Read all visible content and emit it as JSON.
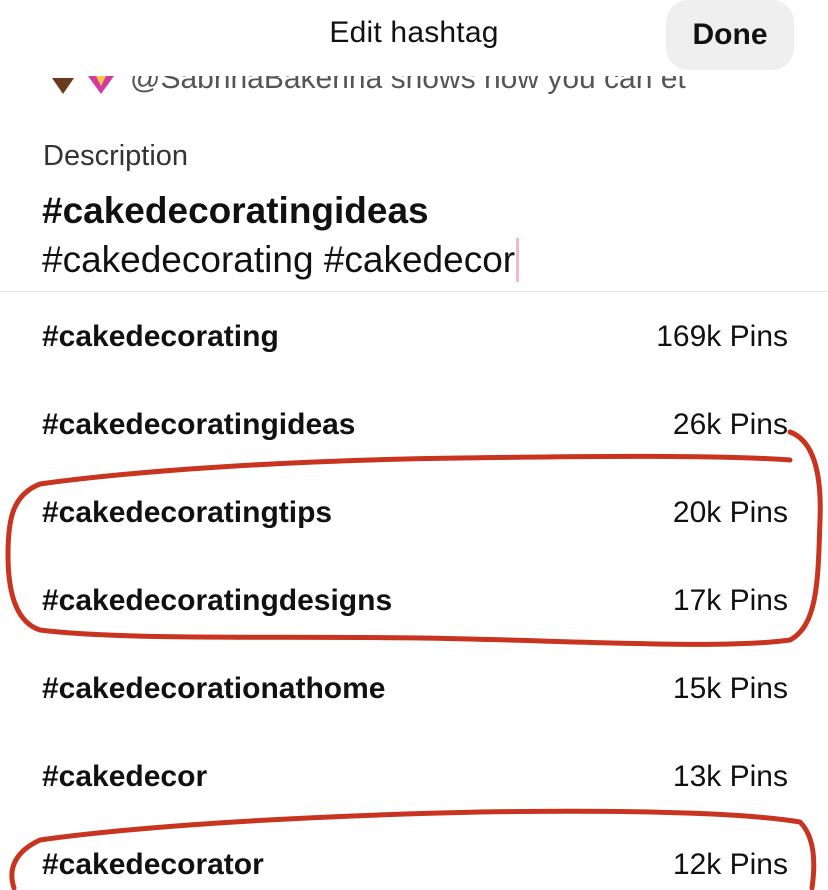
{
  "header": {
    "title": "Edit hashtag",
    "done_label": "Done"
  },
  "peek_row": {
    "text": "@SabrinaBakerina shows how you can et"
  },
  "description": {
    "label": "Description",
    "line1": "#cakedecoratingideas",
    "line2": "#cakedecorating #cakedecor"
  },
  "suggestions": [
    {
      "tag": "#cakedecorating",
      "count": "169k Pins"
    },
    {
      "tag": "#cakedecoratingideas",
      "count": "26k Pins"
    },
    {
      "tag": "#cakedecoratingtips",
      "count": "20k Pins"
    },
    {
      "tag": "#cakedecoratingdesigns",
      "count": "17k Pins"
    },
    {
      "tag": "#cakedecorationathome",
      "count": "15k Pins"
    },
    {
      "tag": "#cakedecor",
      "count": "13k Pins"
    },
    {
      "tag": "#cakedecorator",
      "count": "12k Pins"
    }
  ],
  "colors": {
    "annotation": "#c8341f",
    "done_bg": "#efefef",
    "caret": "#f0b8c8"
  },
  "icons": [
    "heart-icon",
    "sparkle-heart-icon"
  ]
}
